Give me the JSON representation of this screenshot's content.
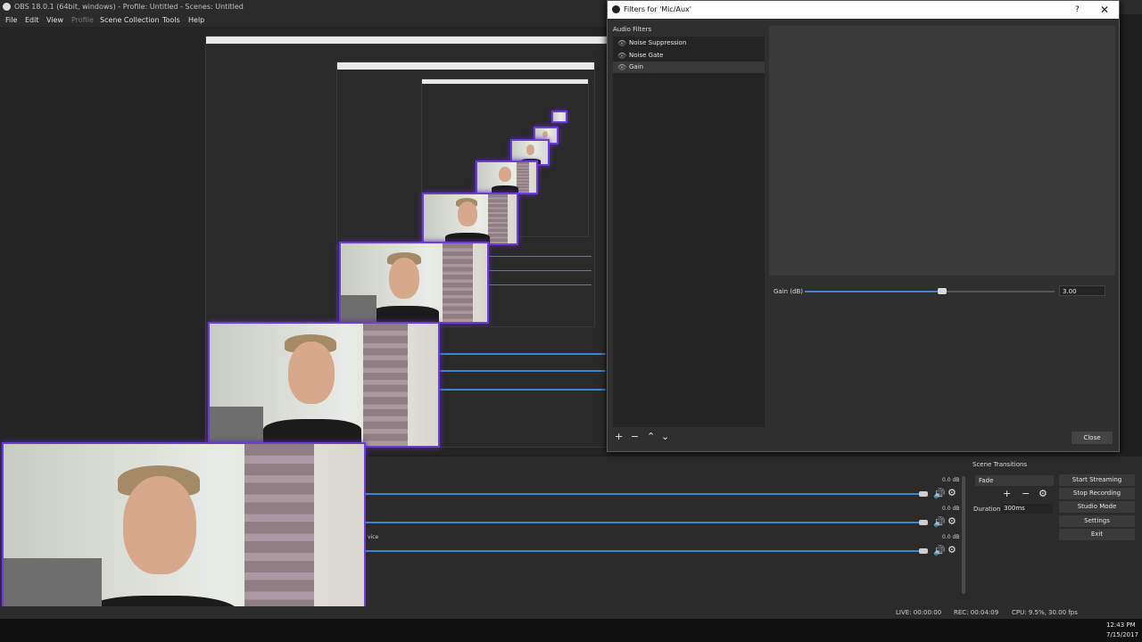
{
  "main_window": {
    "title": "OBS 18.0.1 (64bit, windows) - Profile: Untitled - Scenes: Untitled",
    "menu": [
      "File",
      "Edit",
      "View",
      "Profile",
      "Scene Collection",
      "Tools",
      "Help"
    ]
  },
  "filters_dialog": {
    "title": "Filters for 'Mic/Aux'",
    "help_label": "?",
    "close_icon": "✕",
    "section_header": "Audio Filters",
    "filters": [
      {
        "label": "Noise Suppression",
        "icon": "eye-icon"
      },
      {
        "label": "Noise Gate",
        "icon": "eye-icon"
      },
      {
        "label": "Gain",
        "icon": "eye-icon",
        "selected": true
      }
    ],
    "gain": {
      "label": "Gain (dB)",
      "value_text": "3.00",
      "fraction": 0.55
    },
    "tools": [
      "+",
      "−",
      "⌃",
      "⌄"
    ],
    "close_button": "Close"
  },
  "mixer": {
    "channels": [
      {
        "db": "0.0 dB",
        "level_fraction": 0.98
      },
      {
        "db": "0.0 dB",
        "level_fraction": 0.98
      },
      {
        "db": "0.0 dB",
        "level_fraction": 0.98
      }
    ],
    "partial_label": "vice"
  },
  "scene_transitions": {
    "header": "Scene Transitions",
    "selected": "Fade",
    "add": "+",
    "remove": "−",
    "duration_label": "Duration",
    "duration_value": "300ms"
  },
  "controls": [
    "Start Streaming",
    "Stop Recording",
    "Studio Mode",
    "Settings",
    "Exit"
  ],
  "status": {
    "live": "LIVE: 00:00:00",
    "rec": "REC: 00:04:09",
    "cpu": "CPU: 9.5%, 30.00 fps"
  },
  "taskbar": {
    "time": "12:43 PM",
    "date": "7/15/2017"
  },
  "colors": {
    "accent": "#3a86d6",
    "frame_glow": "#6b3fd6"
  }
}
